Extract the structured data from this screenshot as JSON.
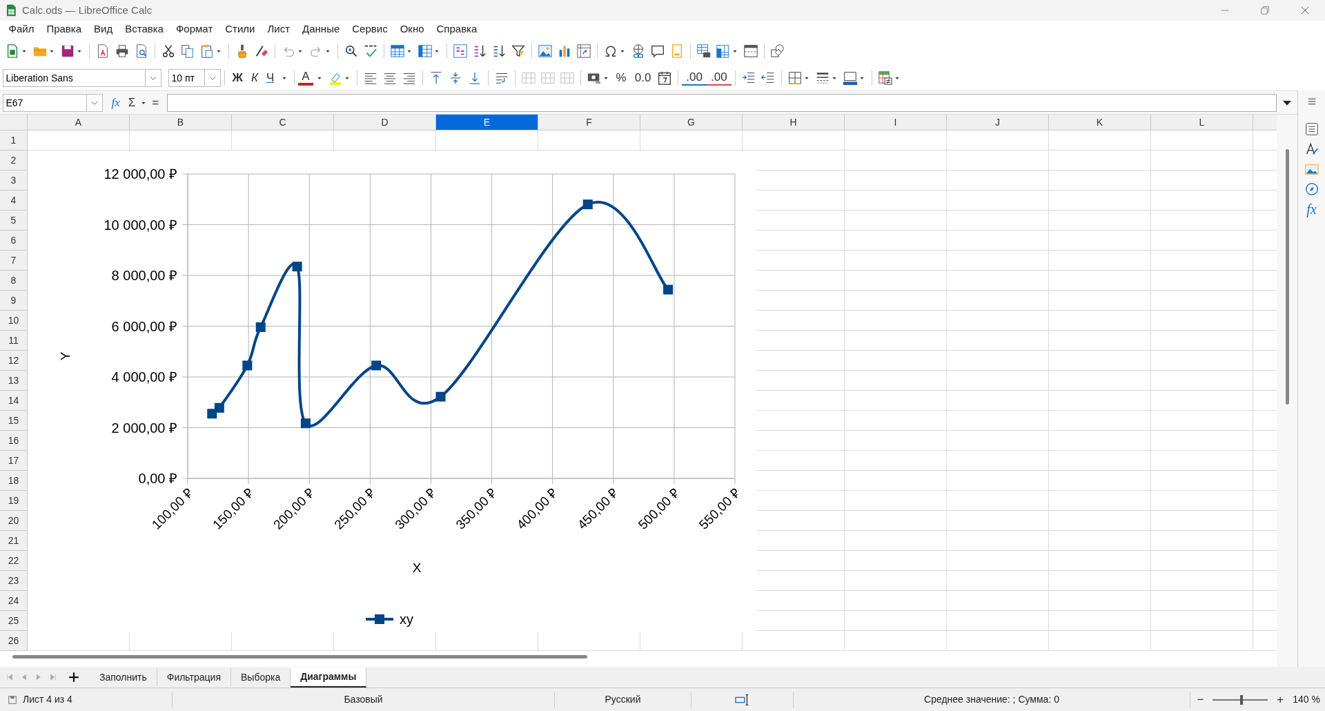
{
  "window": {
    "title": "Calc.ods — LibreOffice Calc"
  },
  "menu": [
    "Файл",
    "Правка",
    "Вид",
    "Вставка",
    "Формат",
    "Стили",
    "Лист",
    "Данные",
    "Сервис",
    "Окно",
    "Справка"
  ],
  "format_toolbar": {
    "font_name": "Liberation Sans",
    "font_size": "10 пт",
    "bold": "Ж",
    "italic": "К",
    "underline": "Ч",
    "font_color": "A",
    "percent": "%",
    "number_format": "0.0",
    "add_decimal": ".00",
    "delete_decimal": ".00"
  },
  "formula_bar": {
    "name_box": "E67",
    "buttons": [
      "fx",
      "Σ",
      "="
    ]
  },
  "columns": [
    {
      "label": "A",
      "selected": false
    },
    {
      "label": "B",
      "selected": false
    },
    {
      "label": "C",
      "selected": false
    },
    {
      "label": "D",
      "selected": false
    },
    {
      "label": "E",
      "selected": true
    },
    {
      "label": "F",
      "selected": false
    },
    {
      "label": "G",
      "selected": false
    },
    {
      "label": "H",
      "selected": false
    },
    {
      "label": "I",
      "selected": false
    },
    {
      "label": "J",
      "selected": false
    },
    {
      "label": "K",
      "selected": false
    },
    {
      "label": "L",
      "selected": false
    }
  ],
  "rows": [
    "1",
    "2",
    "3",
    "4",
    "5",
    "6",
    "7",
    "8",
    "9",
    "10",
    "11",
    "12",
    "13",
    "14",
    "15",
    "16",
    "17",
    "18",
    "19",
    "20",
    "21",
    "22",
    "23",
    "24",
    "25",
    "26"
  ],
  "chart": {
    "chart_data": {
      "type": "line",
      "grid": true,
      "xlabel": "X",
      "ylabel": "Y",
      "x": [
        120,
        126,
        149,
        160,
        190,
        197,
        255,
        308,
        429,
        495
      ],
      "series": [
        {
          "name": "xy",
          "color": "#004586",
          "marker": "square",
          "values": [
            2550,
            2780,
            4450,
            5960,
            8350,
            2170,
            4450,
            3220,
            10800,
            7440
          ]
        }
      ],
      "xlim": [
        100,
        550
      ],
      "ylim": [
        0,
        12000
      ],
      "xticks": [
        {
          "value": 100,
          "label": "100,00 ₽"
        },
        {
          "value": 150,
          "label": "150,00 ₽"
        },
        {
          "value": 200,
          "label": "200,00 ₽"
        },
        {
          "value": 250,
          "label": "250,00 ₽"
        },
        {
          "value": 300,
          "label": "300,00 ₽"
        },
        {
          "value": 350,
          "label": "350,00 ₽"
        },
        {
          "value": 400,
          "label": "400,00 ₽"
        },
        {
          "value": 450,
          "label": "450,00 ₽"
        },
        {
          "value": 500,
          "label": "500,00 ₽"
        },
        {
          "value": 550,
          "label": "550,00 ₽"
        }
      ],
      "yticks": [
        {
          "value": 0,
          "label": "0,00 ₽"
        },
        {
          "value": 2000,
          "label": "2 000,00 ₽"
        },
        {
          "value": 4000,
          "label": "4 000,00 ₽"
        },
        {
          "value": 6000,
          "label": "6 000,00 ₽"
        },
        {
          "value": 8000,
          "label": "8 000,00 ₽"
        },
        {
          "value": 10000,
          "label": "10 000,00 ₽"
        },
        {
          "value": 12000,
          "label": "12 000,00 ₽"
        }
      ]
    }
  },
  "sidebar": {
    "functions_label": "fx"
  },
  "sheet_tabs": [
    {
      "label": "Заполнить",
      "selected": false
    },
    {
      "label": "Фильтрация",
      "selected": false
    },
    {
      "label": "Выборка",
      "selected": false
    },
    {
      "label": "Диаграммы",
      "selected": true
    }
  ],
  "status_bar": {
    "sheet": "Лист 4 из 4",
    "style": "Базовый",
    "language": "Русский",
    "summary": "Среднее значение: ; Сумма: 0",
    "zoom_out": "−",
    "zoom_slider": {
      "level": 0.52
    },
    "zoom_in": "+",
    "zoom": "140 %"
  }
}
